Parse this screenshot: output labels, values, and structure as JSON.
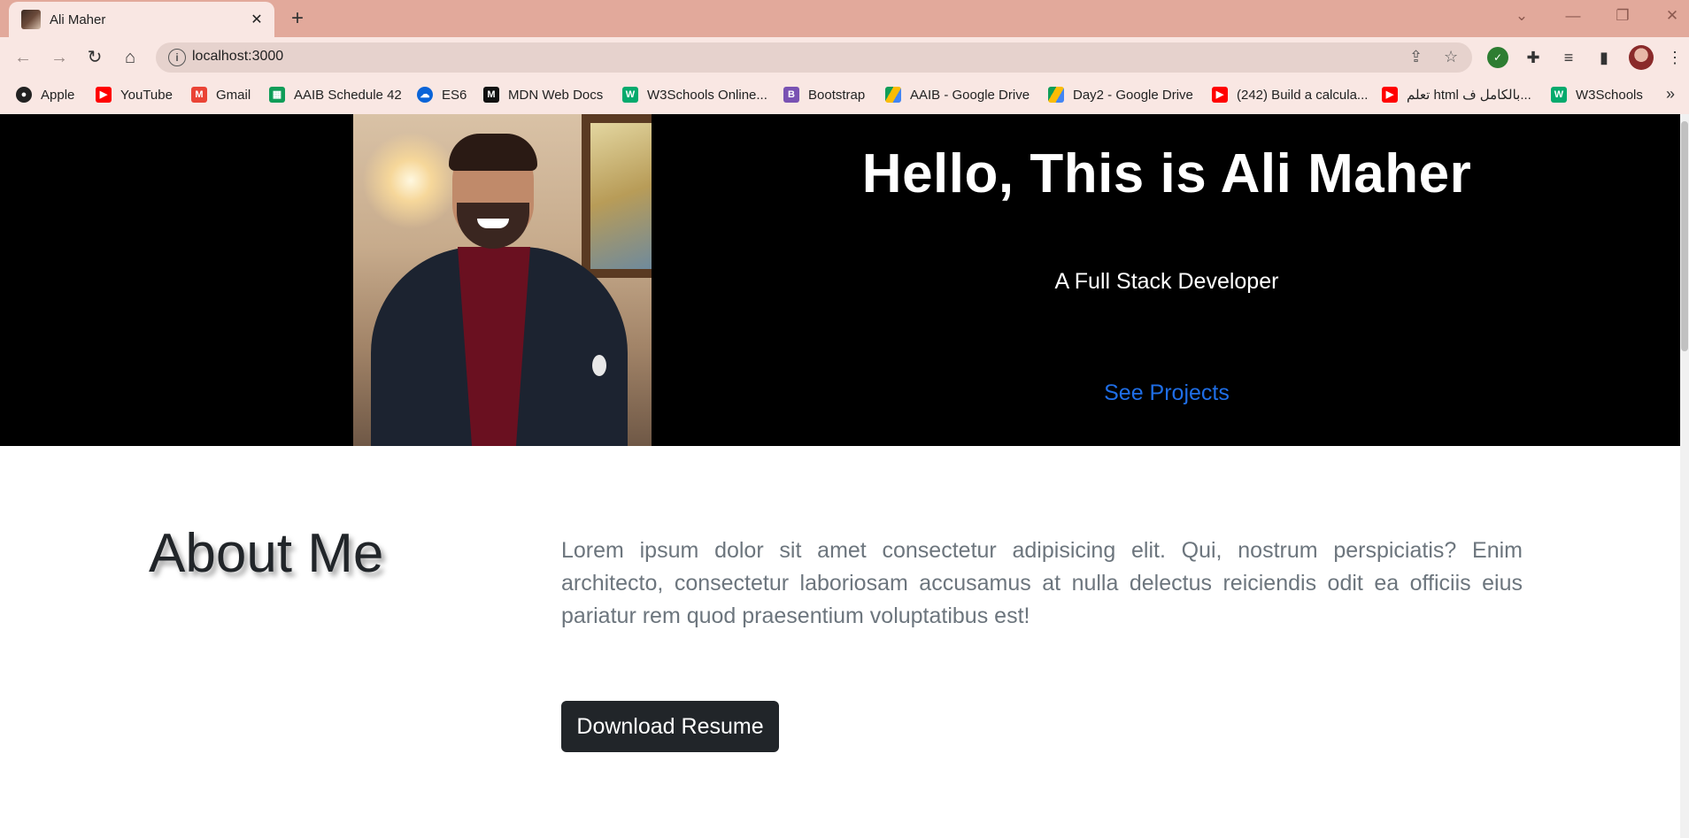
{
  "browser": {
    "tab_title": "Ali Maher",
    "url": "localhost:3000",
    "bookmarks": [
      {
        "label": "Apple",
        "icon": "apple-icon",
        "color": "#222222"
      },
      {
        "label": "YouTube",
        "icon": "youtube-icon",
        "color": "#ff0000"
      },
      {
        "label": "Gmail",
        "icon": "gmail-icon",
        "color": "#ea4335"
      },
      {
        "label": "AAIB Schedule 42",
        "icon": "sheets-icon",
        "color": "#0f9d58"
      },
      {
        "label": "ES6",
        "icon": "onedrive-icon",
        "color": "#0a64d8"
      },
      {
        "label": "MDN Web Docs",
        "icon": "mdn-icon",
        "color": "#111111"
      },
      {
        "label": "W3Schools Online...",
        "icon": "w3schools-icon",
        "color": "#04aa6d"
      },
      {
        "label": "Bootstrap",
        "icon": "bootstrap-icon",
        "color": "#7952b3"
      },
      {
        "label": "AAIB - Google Drive",
        "icon": "google-drive-icon",
        "color": "#fbbc04"
      },
      {
        "label": "Day2 - Google Drive",
        "icon": "google-drive-icon",
        "color": "#fbbc04"
      },
      {
        "label": "(242) Build a calcula...",
        "icon": "youtube-icon",
        "color": "#ff0000"
      },
      {
        "label": "تعلم html بالكامل ف...",
        "icon": "youtube-icon",
        "color": "#ff0000"
      },
      {
        "label": "W3Schools",
        "icon": "w3schools-icon",
        "color": "#04aa6d"
      }
    ]
  },
  "hero": {
    "title": "Hello, This is Ali Maher",
    "subtitle": "A Full Stack Developer",
    "link": "See Projects"
  },
  "about": {
    "title": "About Me",
    "text": "Lorem ipsum dolor sit amet consectetur adipisicing elit. Qui, nostrum perspiciatis? Enim architecto, consectetur laboriosam accusamus at nulla delectus reiciendis odit ea officiis eius pariatur rem quod praesentium voluptatibus est!",
    "button": "Download Resume"
  },
  "colors": {
    "accent_link": "#1f6ee6",
    "hero_bg": "#000000",
    "button_bg": "#212529"
  }
}
